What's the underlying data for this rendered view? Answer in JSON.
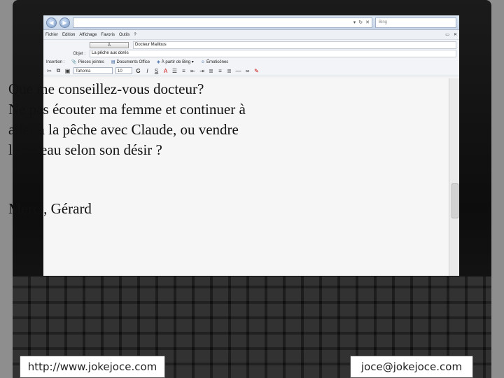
{
  "browser": {
    "search_placeholder": "Bing"
  },
  "menu": [
    "Fichier",
    "Edition",
    "Affichage",
    "Favoris",
    "Outils",
    "?"
  ],
  "compose": {
    "to_button": "À",
    "to_value": "Docteur Maillous",
    "subject_label": "Objet :",
    "subject_value": "La pêche aux dorés",
    "insert_label": "Insertion :",
    "insert_items": [
      "Pièces jointes",
      "Documents Office",
      "À partir de Bing ▾",
      "Émoticônes"
    ],
    "font_name": "Tahoma",
    "font_size": "10"
  },
  "message": {
    "lines": [
      "Que me conseillez-vous docteur?",
      "Ne pas écouter ma femme et continuer à",
      "aller à la pêche avec Claude, ou vendre",
      "le bateau selon son désir ?"
    ],
    "signature": "Merci, Gérard"
  },
  "footer": {
    "website": "http://www.jokejoce.com",
    "email": "joce@jokejoce.com"
  }
}
